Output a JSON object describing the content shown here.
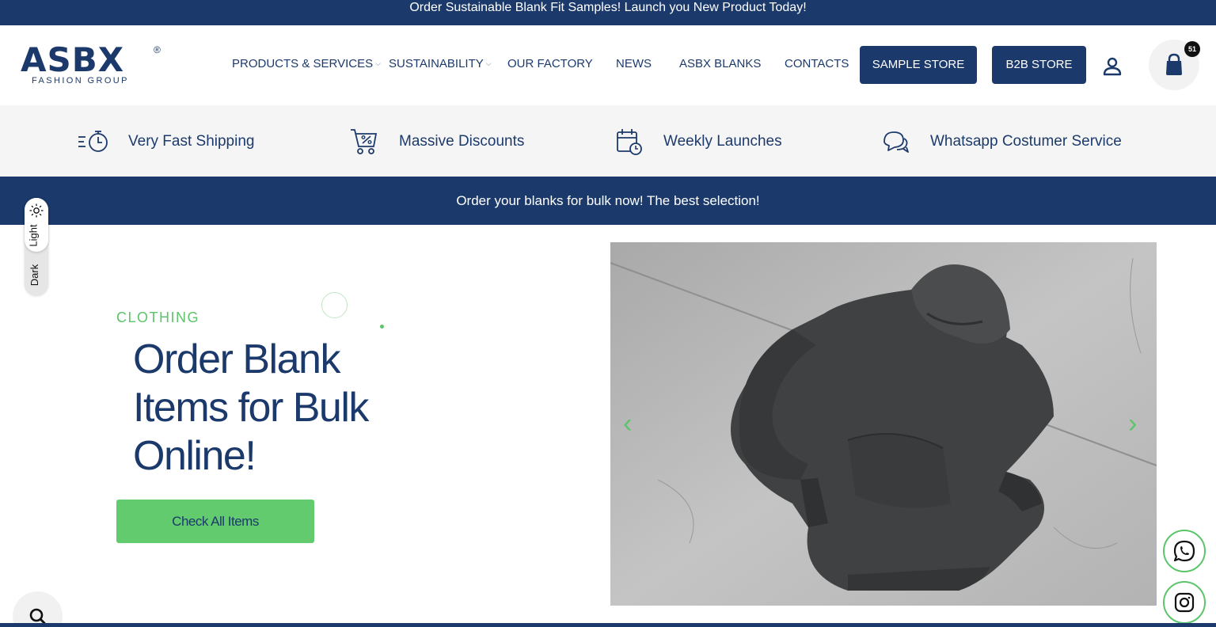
{
  "announcement": "Order Sustainable Blank Fit Samples! Launch you New Product Today!",
  "logo": {
    "name": "ASBX",
    "registered": "®",
    "tagline": "FASHION GROUP"
  },
  "nav": {
    "items": [
      {
        "label": "PRODUCTS & SERVICES",
        "has_dropdown": true
      },
      {
        "label": "SUSTAINABILITY",
        "has_dropdown": true
      },
      {
        "label": "OUR FACTORY",
        "has_dropdown": false
      },
      {
        "label": "NEWS",
        "has_dropdown": false
      },
      {
        "label": "ASBX BLANKS",
        "has_dropdown": false
      },
      {
        "label": "CONTACTS",
        "has_dropdown": false
      }
    ],
    "sample_store": "SAMPLE STORE",
    "b2b_store": "B2B STORE",
    "account_icon": "user-icon",
    "cart_icon": "shopping-bag-icon",
    "cart_count": "51"
  },
  "features": [
    {
      "icon": "stopwatch-icon",
      "label": "Very Fast Shipping"
    },
    {
      "icon": "discount-cart-icon",
      "label": "Massive Discounts"
    },
    {
      "icon": "calendar-clock-icon",
      "label": "Weekly Launches"
    },
    {
      "icon": "chat-bubbles-icon",
      "label": "Whatsapp Costumer Service"
    }
  ],
  "promo": "Order your blanks for bulk now! The best selection!",
  "theme_toggle": {
    "light": "Light",
    "dark": "Dark",
    "selected": "Light"
  },
  "hero": {
    "category": "CLOTHING",
    "title": "Order Blank Items for Bulk Online!",
    "button": "Check All Items",
    "image_subject": "charcoal hoodie on concrete floor"
  },
  "slider": {
    "prev_icon": "chevron-left-icon",
    "next_icon": "chevron-right-icon"
  },
  "floating": {
    "search_icon": "search-icon",
    "whatsapp_icon": "whatsapp-icon",
    "instagram_icon": "instagram-icon"
  },
  "colors": {
    "navy": "#1b3a6b",
    "green": "#62cb6d",
    "feature_bar": "#f5f5f5"
  }
}
